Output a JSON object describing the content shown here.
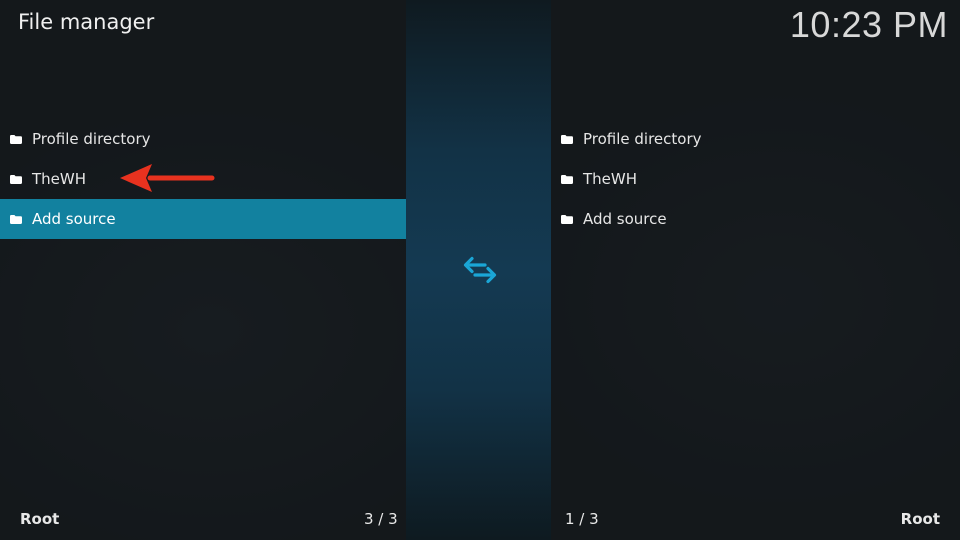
{
  "header": {
    "title": "File manager",
    "clock": "10:23 PM"
  },
  "left_panel": {
    "items": [
      {
        "label": "Profile directory",
        "icon": "folder-icon"
      },
      {
        "label": "TheWH",
        "icon": "folder-icon"
      },
      {
        "label": "Add source",
        "icon": "folder-icon",
        "selected": true
      }
    ],
    "footer_path": "Root",
    "footer_count": "3 / 3"
  },
  "right_panel": {
    "items": [
      {
        "label": "Profile directory",
        "icon": "folder-icon"
      },
      {
        "label": "TheWH",
        "icon": "folder-icon"
      },
      {
        "label": "Add source",
        "icon": "folder-icon"
      }
    ],
    "footer_path": "Root",
    "footer_count": "1 / 3"
  },
  "center": {
    "icon": "swap-arrows-icon"
  },
  "annotation": {
    "icon": "red-arrow-icon",
    "color": "#e8321f"
  },
  "colors": {
    "accent": "#12819f",
    "swap_icon": "#1aa6d6",
    "background": "#15191c"
  }
}
